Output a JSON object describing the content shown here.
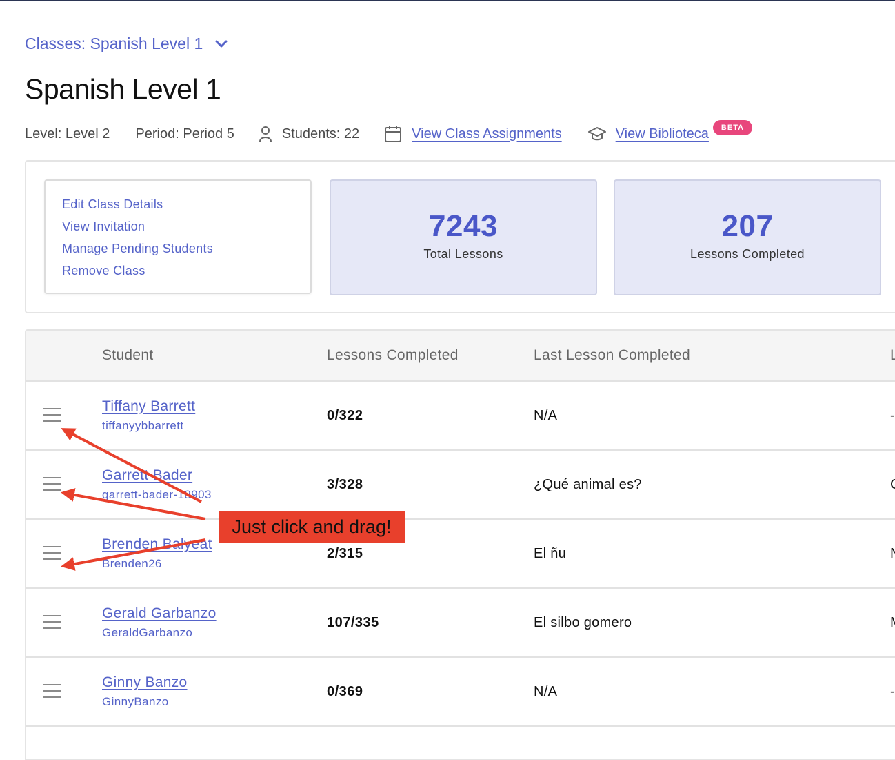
{
  "breadcrumb": {
    "label": "Classes: Spanish Level 1"
  },
  "page_title": "Spanish Level 1",
  "meta": {
    "level": "Level: Level 2",
    "period": "Period: Period 5",
    "students": "Students: 22",
    "assignments_link": "View Class Assignments",
    "biblioteca_link": "View Biblioteca",
    "beta_badge": "BETA"
  },
  "class_actions": [
    {
      "label": "Edit Class Details"
    },
    {
      "label": "View Invitation"
    },
    {
      "label": "Manage Pending Students"
    },
    {
      "label": "Remove Class"
    }
  ],
  "stats": {
    "total_lessons": {
      "value": "7243",
      "label": "Total Lessons"
    },
    "lessons_completed": {
      "value": "207",
      "label": "Lessons Completed"
    }
  },
  "table": {
    "headers": {
      "student": "Student",
      "lessons_completed": "Lessons Completed",
      "last_lesson": "Last Lesson Completed",
      "clipped": "L"
    },
    "rows": [
      {
        "name": "Tiffany Barrett",
        "username": "tiffanyybbarrett",
        "lessons": "0/322",
        "last": "N/A",
        "clipped": "-"
      },
      {
        "name": "Garrett Bader",
        "username": "garrett-bader-18903",
        "lessons": "3/328",
        "last": "¿Qué animal es?",
        "clipped": "C"
      },
      {
        "name": "Brenden Balyeat",
        "username": "Brenden26",
        "lessons": "2/315",
        "last": "El ñu",
        "clipped": "N"
      },
      {
        "name": "Gerald Garbanzo",
        "username": "GeraldGarbanzo",
        "lessons": "107/335",
        "last": "El silbo gomero",
        "clipped": "M"
      },
      {
        "name": "Ginny Banzo",
        "username": "GinnyBanzo",
        "lessons": "0/369",
        "last": "N/A",
        "clipped": "-"
      }
    ]
  },
  "annotation": {
    "text": "Just click and drag!",
    "color": "#e8402c"
  },
  "colors": {
    "accent": "#5563c9",
    "stat_bg": "#e6e8f7",
    "stat_number": "#4a57c8",
    "beta": "#e8467c"
  }
}
